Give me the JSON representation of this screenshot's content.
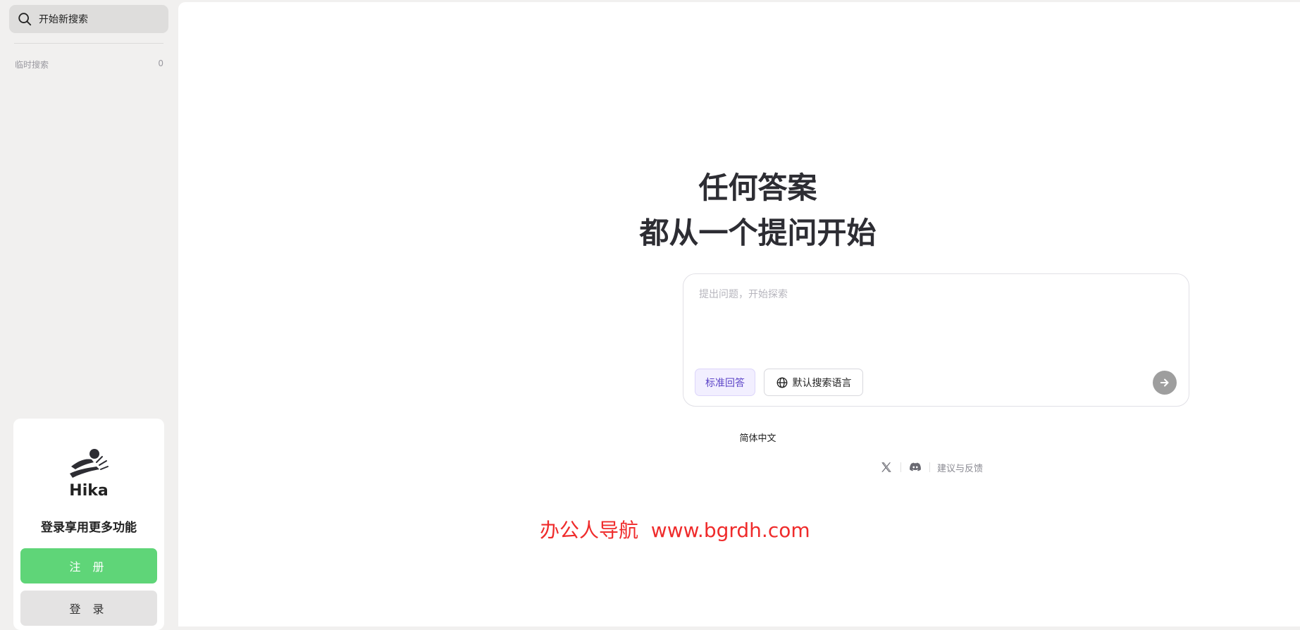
{
  "sidebar": {
    "new_search_label": "开始新搜索",
    "temp_search": {
      "label": "临时搜索",
      "count": "0"
    },
    "login_card": {
      "brand": "Hika",
      "promo": "登录享用更多功能",
      "register_label": "注 册",
      "signin_label": "登 录"
    }
  },
  "main": {
    "headline_line1": "任何答案",
    "headline_line2": "都从一个提问开始",
    "query": {
      "placeholder": "提出问题，开始探索",
      "value": "",
      "mode_label": "标准回答",
      "language_label": "默认搜索语言"
    },
    "ui_language": "简体中文",
    "feedback_label": "建议与反馈",
    "watermark": "办公人导航  www.bgrdh.com"
  },
  "colors": {
    "sidebar_bg": "#f1f0ef",
    "accent_purple": "#5b43c7",
    "register_green": "#5fd578",
    "watermark_red": "#ef2b2b",
    "send_gray": "#9e9e9e"
  },
  "icons": {
    "search": "search-icon",
    "logo": "hika-logo",
    "globe": "globe-icon",
    "send": "arrow-right-icon",
    "x": "x-twitter-icon",
    "discord": "discord-icon"
  }
}
